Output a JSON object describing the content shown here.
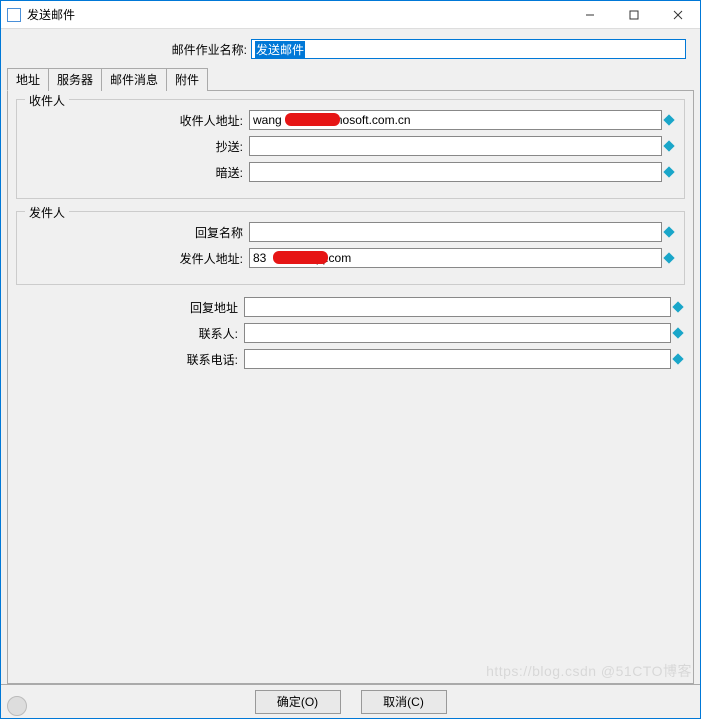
{
  "window": {
    "title": "发送邮件"
  },
  "topForm": {
    "jobNameLabel": "邮件作业名称:",
    "jobNameValue": "发送邮件"
  },
  "tabs": {
    "address": "地址",
    "server": "服务器",
    "message": "邮件消息",
    "attachment": "附件"
  },
  "recipient": {
    "groupTitle": "收件人",
    "addressLabel": "收件人地址:",
    "addressValue": "wang          @sinosoft.com.cn",
    "ccLabel": "抄送:",
    "ccValue": "",
    "bccLabel": "暗送:",
    "bccValue": ""
  },
  "sender": {
    "groupTitle": "发件人",
    "replyNameLabel": "回复名称",
    "replyNameValue": "",
    "senderAddressLabel": "发件人地址:",
    "senderAddressValue": "83          @qq.com"
  },
  "extra": {
    "replyAddressLabel": "回复地址",
    "replyAddressValue": "",
    "contactLabel": "联系人:",
    "contactValue": "",
    "phoneLabel": "联系电话:",
    "phoneValue": ""
  },
  "footer": {
    "ok": "确定(O)",
    "cancel": "取消(C)"
  },
  "watermark": "https://blog.csdn   @51CTO博客"
}
